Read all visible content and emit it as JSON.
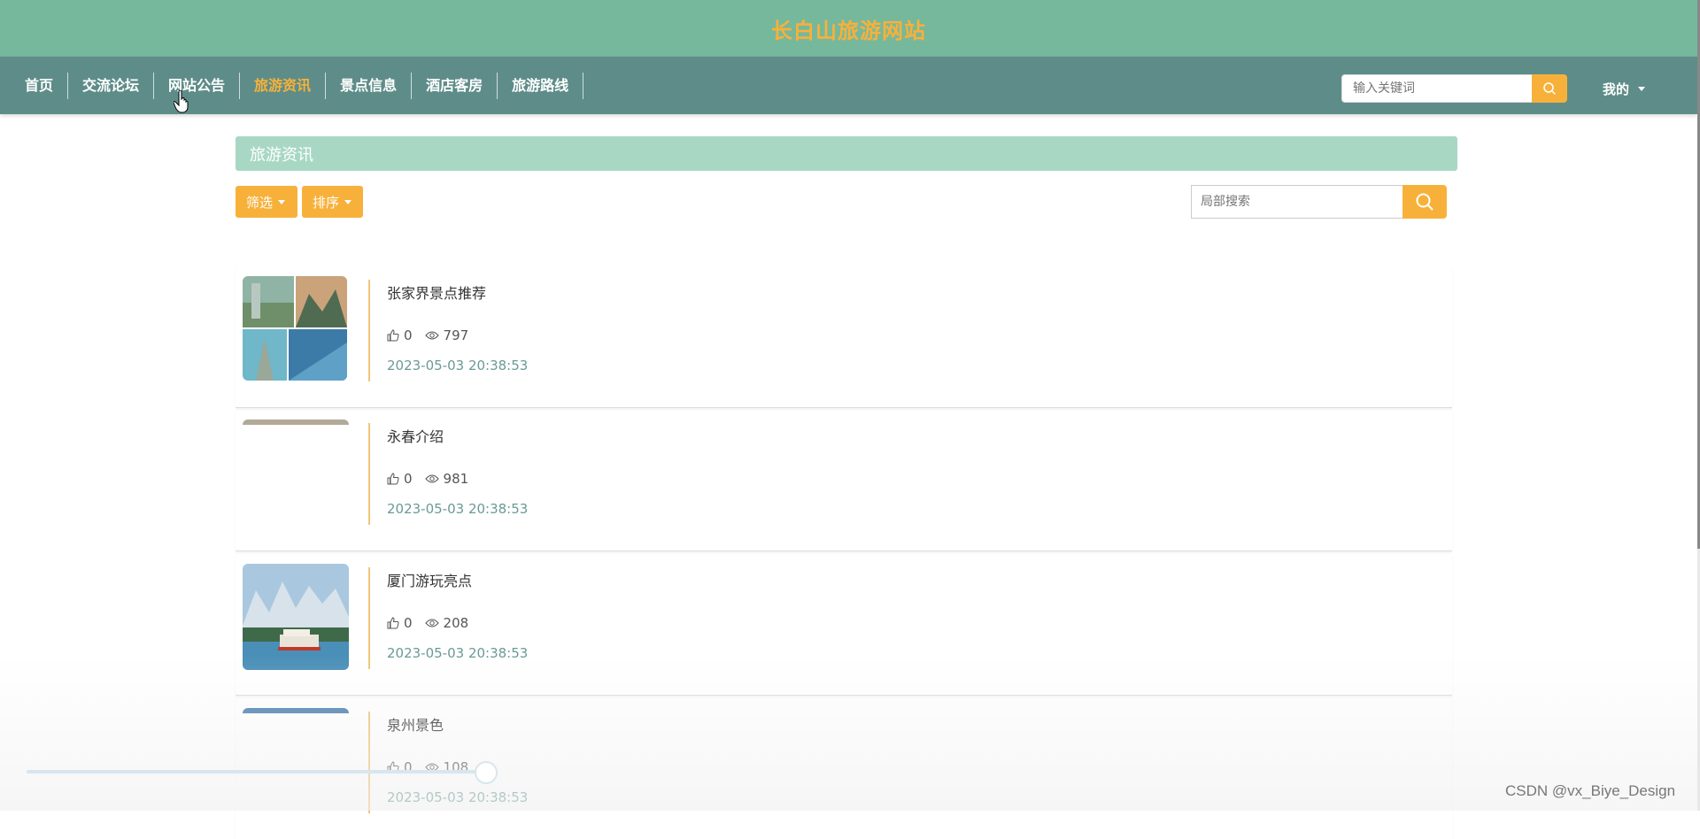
{
  "header": {
    "title": "长白山旅游网站"
  },
  "nav": {
    "items": [
      "首页",
      "交流论坛",
      "网站公告",
      "旅游资讯",
      "景点信息",
      "酒店客房",
      "旅游路线"
    ],
    "active_index": 3,
    "search_placeholder": "输入关键词",
    "mine_label": "我的"
  },
  "section": {
    "title": "旅游资讯"
  },
  "toolbar": {
    "filter_label": "筛选",
    "sort_label": "排序",
    "local_search_placeholder": "局部搜索"
  },
  "news": [
    {
      "title": "张家界景点推荐",
      "likes": "0",
      "views": "797",
      "time": "2023-05-03 20:38:53"
    },
    {
      "title": "永春介绍",
      "likes": "0",
      "views": "981",
      "time": "2023-05-03 20:38:53"
    },
    {
      "title": "厦门游玩亮点",
      "likes": "0",
      "views": "208",
      "time": "2023-05-03 20:38:53"
    },
    {
      "title": "泉州景色",
      "likes": "0",
      "views": "108",
      "time": "2023-05-03 20:38:53"
    }
  ],
  "watermark": "CSDN @vx_Biye_Design",
  "colors": {
    "accent": "#f7b13a",
    "title_bar": "#76b89c",
    "nav_bar": "#5e8d89",
    "section_bar": "#a8d8c4"
  }
}
